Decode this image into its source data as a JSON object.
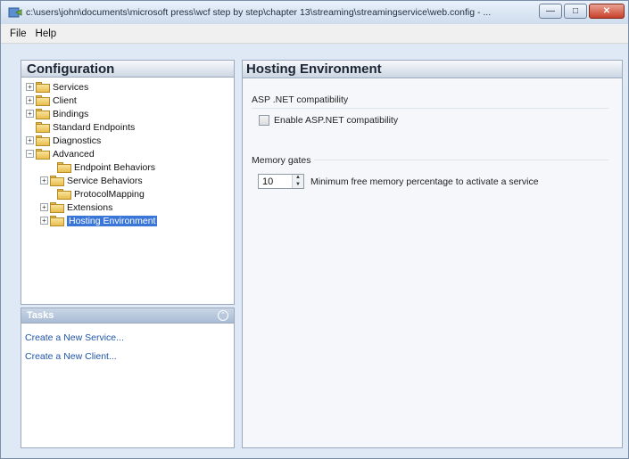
{
  "window": {
    "title": "c:\\users\\john\\documents\\microsoft press\\wcf step by step\\chapter 13\\streaming\\streamingservice\\web.config - ...",
    "controls": {
      "minimize": "—",
      "maximize": "□",
      "close": "✕"
    }
  },
  "menu": {
    "items": [
      "File",
      "Help"
    ]
  },
  "configuration": {
    "header": "Configuration",
    "tree": [
      {
        "label": "Services",
        "expander": "+"
      },
      {
        "label": "Client",
        "expander": "+"
      },
      {
        "label": "Bindings",
        "expander": "+"
      },
      {
        "label": "Standard Endpoints",
        "expander": ""
      },
      {
        "label": "Diagnostics",
        "expander": "+"
      },
      {
        "label": "Advanced",
        "expander": "−"
      },
      {
        "label": "Endpoint Behaviors",
        "expander": ""
      },
      {
        "label": "Service Behaviors",
        "expander": "+"
      },
      {
        "label": "ProtocolMapping",
        "expander": ""
      },
      {
        "label": "Extensions",
        "expander": "+"
      },
      {
        "label": "Hosting Environment",
        "expander": "+",
        "selected": true
      }
    ]
  },
  "tasks": {
    "header": "Tasks",
    "links": [
      "Create a New Service...",
      "Create a New Client..."
    ]
  },
  "hosting": {
    "header": "Hosting Environment",
    "asp_section": "ASP .NET compatibility",
    "asp_checkbox_label": "Enable ASP.NET compatibility",
    "asp_checked": false,
    "memory_section": "Memory gates",
    "memory_value": "10",
    "memory_label": "Minimum free memory percentage to activate a service"
  },
  "colors": {
    "selection": "#3a76d8",
    "link": "#1f55a8",
    "folder": "#e8be4e"
  }
}
